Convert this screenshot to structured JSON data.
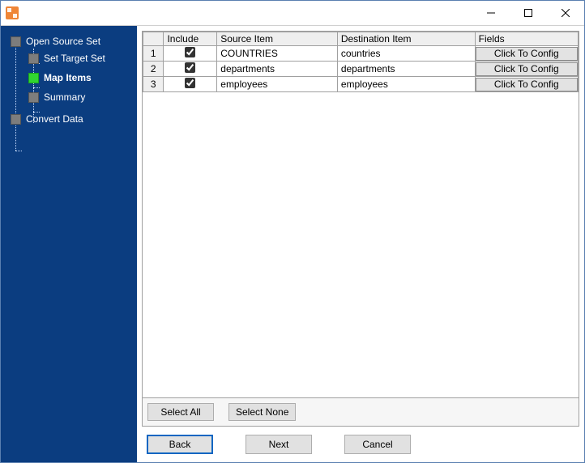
{
  "sidebar": {
    "root": "Open Source Set",
    "children": [
      {
        "label": "Set Target Set",
        "active": false
      },
      {
        "label": "Map Items",
        "active": true
      },
      {
        "label": "Summary",
        "active": false
      }
    ],
    "tail": "Convert Data"
  },
  "grid": {
    "headers": {
      "include": "Include",
      "source": "Source Item",
      "dest": "Destination Item",
      "fields": "Fields"
    },
    "config_label": "Click To Config",
    "rows": [
      {
        "n": "1",
        "include": true,
        "source": "COUNTRIES",
        "dest": "countries"
      },
      {
        "n": "2",
        "include": true,
        "source": "departments",
        "dest": "departments"
      },
      {
        "n": "3",
        "include": true,
        "source": "employees",
        "dest": "employees"
      }
    ]
  },
  "buttons": {
    "select_all": "Select All",
    "select_none": "Select None",
    "back": "Back",
    "next": "Next",
    "cancel": "Cancel"
  }
}
